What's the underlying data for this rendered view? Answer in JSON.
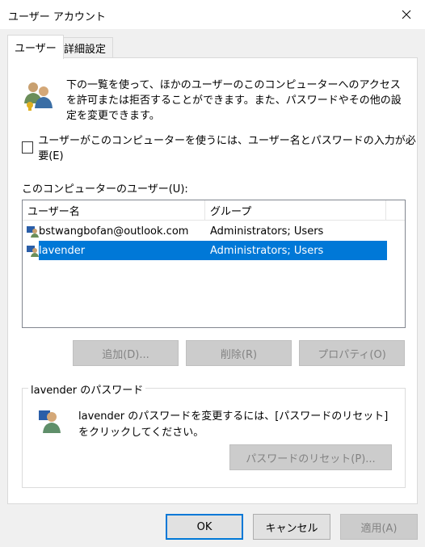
{
  "window": {
    "title": "ユーザー アカウント"
  },
  "tabs": [
    {
      "label": "ユーザー"
    },
    {
      "label": "詳細設定"
    }
  ],
  "users_tab": {
    "description": "下の一覧を使って、ほかのユーザーのこのコンピューターへのアクセスを許可または拒否することができます。また、パスワードやその他の設定を変更できます。",
    "require_login_checkbox": {
      "label": "ユーザーがこのコンピューターを使うには、ユーザー名とパスワードの入力が必要(E)",
      "checked": false
    },
    "users_list_label": "このコンピューターのユーザー(U):",
    "columns": [
      "ユーザー名",
      "グループ"
    ],
    "users": [
      {
        "name": "bstwangbofan@outlook.com",
        "group": "Administrators; Users",
        "selected": false
      },
      {
        "name": "lavender",
        "group": "Administrators; Users",
        "selected": true
      }
    ],
    "buttons": {
      "add": "追加(D)...",
      "remove": "削除(R)",
      "properties": "プロパティ(O)"
    },
    "password_group": {
      "title": "lavender のパスワード",
      "description": "lavender のパスワードを変更するには、[パスワードのリセット] をクリックしてください。",
      "reset_button": "パスワードのリセット(P)..."
    }
  },
  "dialog_buttons": {
    "ok": "OK",
    "cancel": "キャンセル",
    "apply": "適用(A)"
  },
  "colors": {
    "selection": "#0078d7",
    "panel": "#ffffff",
    "window_bg": "#f0f0f0"
  }
}
